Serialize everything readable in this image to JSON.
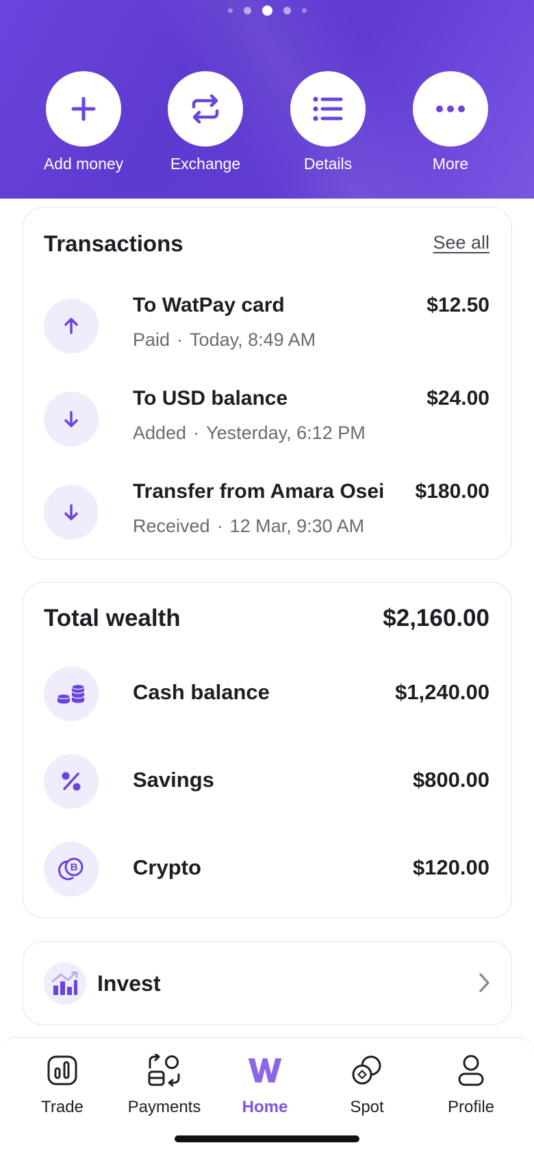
{
  "carousel": {
    "page_count": 5,
    "active_index": 2
  },
  "actions": [
    {
      "label": "Add money",
      "icon": "plus-icon"
    },
    {
      "label": "Exchange",
      "icon": "exchange-icon"
    },
    {
      "label": "Details",
      "icon": "list-icon"
    },
    {
      "label": "More",
      "icon": "more-dots-icon"
    }
  ],
  "transactions": {
    "title": "Transactions",
    "see_all": "See all",
    "items": [
      {
        "title": "To WatPay card",
        "status": "Paid",
        "time": "Today, 8:49 AM",
        "amount": "$12.50",
        "direction": "up",
        "icon": "arrow-up-icon"
      },
      {
        "title": "To USD balance",
        "status": "Added",
        "time": "Yesterday, 6:12 PM",
        "amount": "$24.00",
        "direction": "down",
        "icon": "arrow-down-icon"
      },
      {
        "title": "Transfer from Amara Osei",
        "status": "Received",
        "time": "12 Mar, 9:30 AM",
        "amount": "$180.00",
        "direction": "down",
        "icon": "arrow-down-icon"
      }
    ]
  },
  "wealth": {
    "title": "Total wealth",
    "total": "$2,160.00",
    "items": [
      {
        "label": "Cash balance",
        "amount": "$1,240.00",
        "icon": "coins-icon"
      },
      {
        "label": "Savings",
        "amount": "$800.00",
        "icon": "percent-icon"
      },
      {
        "label": "Crypto",
        "amount": "$120.00",
        "icon": "bitcoin-icon"
      }
    ]
  },
  "invest": {
    "label": "Invest",
    "icon": "bar-chart-growth-icon"
  },
  "nav": {
    "active": "Home",
    "items": [
      {
        "label": "Trade",
        "icon": "trade-icon"
      },
      {
        "label": "Payments",
        "icon": "payments-icon"
      },
      {
        "label": "Home",
        "icon": "home-logo-icon"
      },
      {
        "label": "Spot",
        "icon": "spot-icon"
      },
      {
        "label": "Profile",
        "icon": "profile-icon"
      }
    ]
  },
  "colors": {
    "brand": "#6a44dc",
    "accent": "#7b55e3",
    "icon_bg": "#efecfb",
    "text": "#1f1d24",
    "muted": "#6b6873"
  }
}
